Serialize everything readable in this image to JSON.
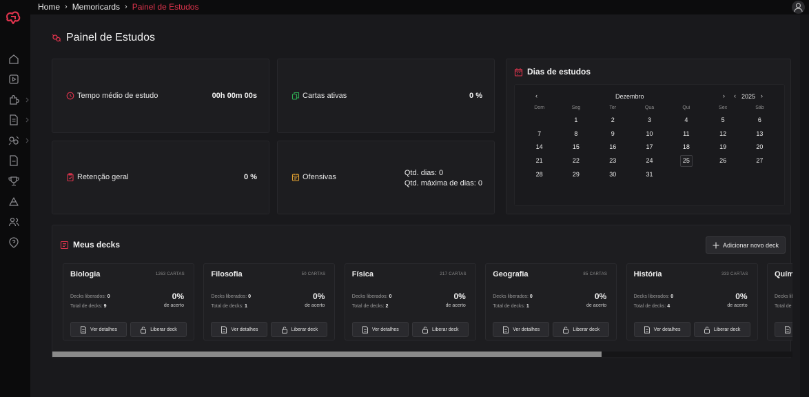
{
  "breadcrumb": {
    "home": "Home",
    "section": "Memoricards",
    "current": "Painel de Estudos"
  },
  "page_title": "Painel de Estudos",
  "stats": {
    "avg_time_label": "Tempo médio de estudo",
    "avg_time_value": "00h 00m 00s",
    "active_cards_label": "Cartas ativas",
    "active_cards_value": "0 %",
    "retention_label": "Retenção geral",
    "retention_value": "0 %",
    "offensive_label": "Ofensivas",
    "days_qty_label": "Qtd. dias:",
    "days_qty_value": "0",
    "max_days_label": "Qtd. máxima de dias:",
    "max_days_value": "0"
  },
  "calendar": {
    "title": "Dias de estudos",
    "month": "Dezembro",
    "year": "2025",
    "prev_month": "‹",
    "next_month": "›",
    "prev_year": "‹",
    "next_year": "›",
    "weekdays": [
      "Dom",
      "Seg",
      "Ter",
      "Qua",
      "Qui",
      "Sex",
      "Sáb"
    ],
    "leading_blanks": 1,
    "days_in_month": 31,
    "today": 25
  },
  "decks_section": {
    "title": "Meus decks",
    "add_button": "Adicionar novo deck",
    "released_label": "Decks liberados:",
    "total_label": "Total de decks:",
    "hit_label": "de acerto",
    "details_button": "Ver detalhes",
    "release_button": "Liberar deck",
    "decks": [
      {
        "name": "Biologia",
        "cards": "1263 CARTAS",
        "released": "0",
        "total": "9",
        "pct": "0%"
      },
      {
        "name": "Filosofia",
        "cards": "50 CARTAS",
        "released": "0",
        "total": "1",
        "pct": "0%"
      },
      {
        "name": "Física",
        "cards": "217 CARTAS",
        "released": "0",
        "total": "2",
        "pct": "0%"
      },
      {
        "name": "Geografia",
        "cards": "85 CARTAS",
        "released": "0",
        "total": "1",
        "pct": "0%"
      },
      {
        "name": "História",
        "cards": "333 CARTAS",
        "released": "0",
        "total": "4",
        "pct": "0%"
      },
      {
        "name": "Quím",
        "cards": "",
        "released": "",
        "total": "",
        "pct": ""
      }
    ]
  },
  "colors": {
    "accent": "#e0344d",
    "green_icon": "#2fae54",
    "orange_icon": "#e3a12f"
  }
}
